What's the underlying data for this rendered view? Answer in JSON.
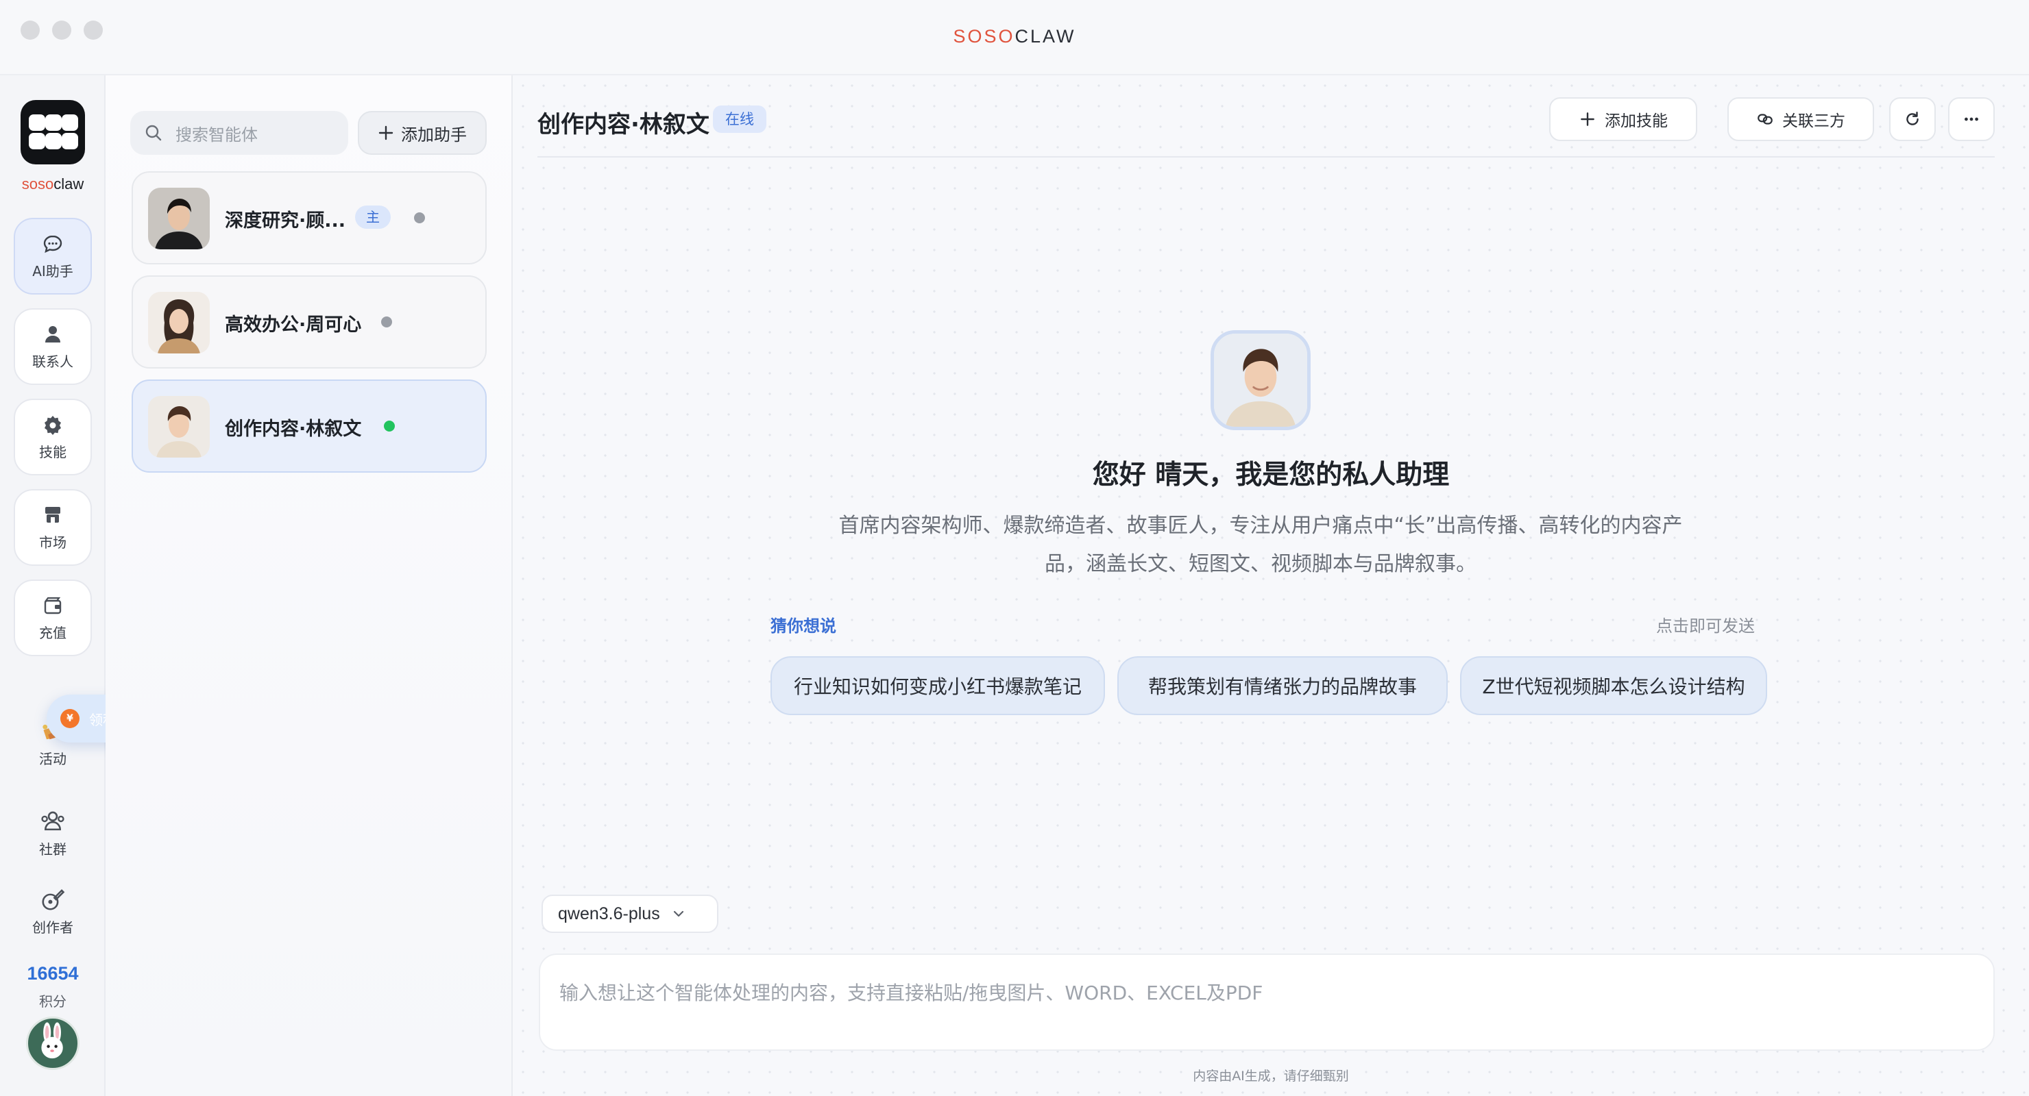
{
  "app_title_part1": "SOSO",
  "app_title_part2": "CLAW",
  "rail": {
    "brand_part1": "soso",
    "brand_part2": "claw",
    "items": [
      {
        "label": "AI助手",
        "icon": "chat-bubble-icon"
      },
      {
        "label": "联系人",
        "icon": "person-icon"
      },
      {
        "label": "技能",
        "icon": "gear-icon"
      },
      {
        "label": "市场",
        "icon": "store-icon"
      },
      {
        "label": "充值",
        "icon": "wallet-icon"
      }
    ],
    "activity_label": "活动",
    "community_label": "社群",
    "creator_label": "创作者",
    "claim_label": "领积分",
    "points_value": "16654",
    "points_label": "积分"
  },
  "list_panel": {
    "search_placeholder": "搜索智能体",
    "add_assistant_label": "添加助手",
    "assistants": [
      {
        "name": "深度研究·顾...",
        "badge": "主",
        "online": false
      },
      {
        "name": "高效办公·周可心",
        "badge": "",
        "online": false
      },
      {
        "name": "创作内容·林叙文",
        "badge": "",
        "online": true
      }
    ]
  },
  "main": {
    "chat_title": "创作内容·林叙文",
    "status_label": "在线",
    "add_skill_label": "添加技能",
    "link_third_party_label": "关联三方",
    "greeting": "您好 晴天，我是您的私人助理",
    "description": "首席内容架构师、爆款缔造者、故事匠人，专注从用户痛点中“长”出高传播、高转化的内容产品，涵盖长文、短图文、视频脚本与品牌叙事。",
    "guess_label": "猜你想说",
    "send_hint": "点击即可发送",
    "suggestions": [
      "行业知识如何变成小红书爆款笔记",
      "帮我策划有情绪张力的品牌故事",
      "Z世代短视频脚本怎么设计结构"
    ],
    "model_name": "qwen3.6-plus",
    "input_placeholder": "输入想让这个智能体处理的内容，支持直接粘贴/拖曳图片、WORD、EXCEL及PDF",
    "disclaimer": "内容由AI生成，请仔细甄别"
  },
  "colors": {
    "accent": "#3b6fd4",
    "brand_red": "#e0533d",
    "online_green": "#22c35e"
  }
}
